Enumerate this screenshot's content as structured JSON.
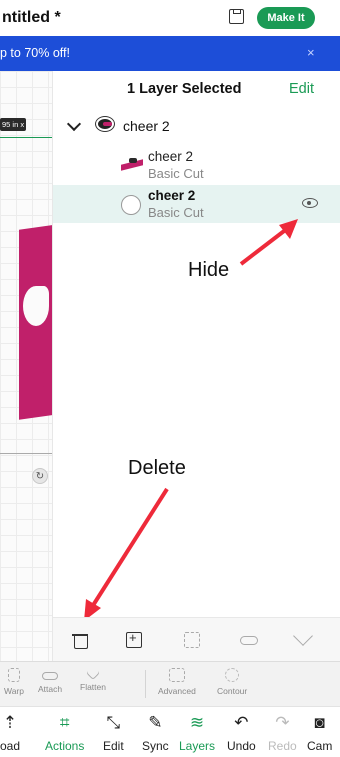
{
  "header": {
    "title": "ntitled *",
    "make_it_label": "Make It"
  },
  "promo": {
    "text": "p to 70% off!",
    "close": "×"
  },
  "canvas": {
    "dimension_badge": "95 in x"
  },
  "layers_panel": {
    "title": "1 Layer Selected",
    "edit_label": "Edit",
    "group": {
      "name": "cheer 2"
    },
    "layers": [
      {
        "name": "cheer 2",
        "operation": "Basic Cut",
        "selected": false
      },
      {
        "name": "cheer 2",
        "operation": "Basic Cut",
        "selected": true
      }
    ]
  },
  "annotations": {
    "hide": "Hide",
    "delete": "Delete",
    "arrow_color": "#ee2a3a"
  },
  "layer_actions": [
    {
      "icon": "trash-icon"
    },
    {
      "icon": "duplicate-icon"
    },
    {
      "icon": "group-icon"
    },
    {
      "icon": "attach-icon"
    },
    {
      "icon": "flatten-icon"
    }
  ],
  "tools": {
    "warp": "Warp",
    "attach": "Attach",
    "flatten": "Flatten",
    "advanced": "Advanced",
    "contour": "Contour"
  },
  "bottom_nav": {
    "upload": "oad",
    "actions": "Actions",
    "edit": "Edit",
    "sync": "Sync",
    "layers": "Layers",
    "undo": "Undo",
    "redo": "Redo",
    "camera": "Cam"
  },
  "colors": {
    "accent_green": "#1a9a55",
    "promo_blue": "#1d4ed8",
    "shape_magenta": "#c0206a",
    "selected_row": "#e6f3f1"
  }
}
